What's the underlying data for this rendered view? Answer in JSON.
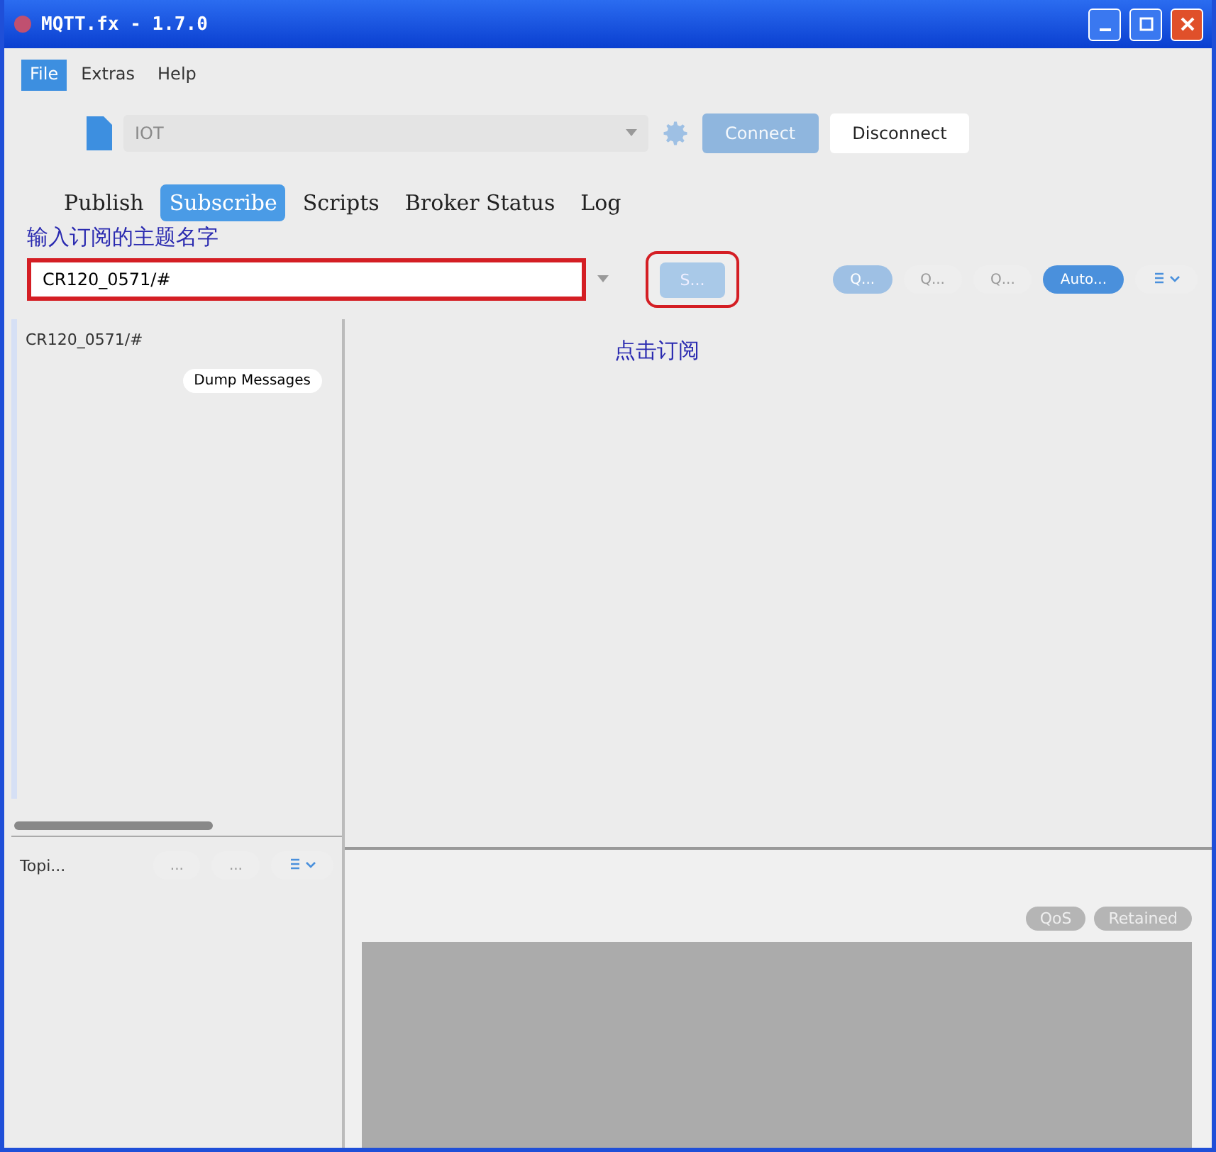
{
  "window": {
    "title": "MQTT.fx - 1.7.0"
  },
  "menu": [
    {
      "label": "File",
      "selected": true
    },
    {
      "label": "Extras",
      "selected": false
    },
    {
      "label": "Help",
      "selected": false
    }
  ],
  "toolbar": {
    "profile": "IOT",
    "connect": {
      "label": "Connect",
      "disabled": true
    },
    "disconnect": {
      "label": "Disconnect",
      "disabled": false
    }
  },
  "tabs": [
    {
      "label": "Publish",
      "selected": false
    },
    {
      "label": "Subscribe",
      "selected": true
    },
    {
      "label": "Scripts",
      "selected": false
    },
    {
      "label": "Broker Status",
      "selected": false
    },
    {
      "label": "Log",
      "selected": false
    }
  ],
  "annotations": {
    "topic_hint": "输入订阅的主题名字",
    "click_hint": "点击订阅"
  },
  "subscribe_bar": {
    "topic": "CR120_0571/#",
    "subscribe_button": "S...",
    "qos_buttons": [
      {
        "label": "Q...",
        "selected": true
      },
      {
        "label": "Q...",
        "selected": false
      },
      {
        "label": "Q...",
        "selected": false
      }
    ],
    "autoscroll": "Auto..."
  },
  "subscriptions": [
    {
      "topic": "CR120_0571/#",
      "action": "Dump Messages"
    }
  ],
  "topics_panel": {
    "label": "Topi...",
    "buttons": [
      "...",
      "..."
    ]
  },
  "message_detail": {
    "tags": [
      "QoS",
      "Retained"
    ]
  }
}
